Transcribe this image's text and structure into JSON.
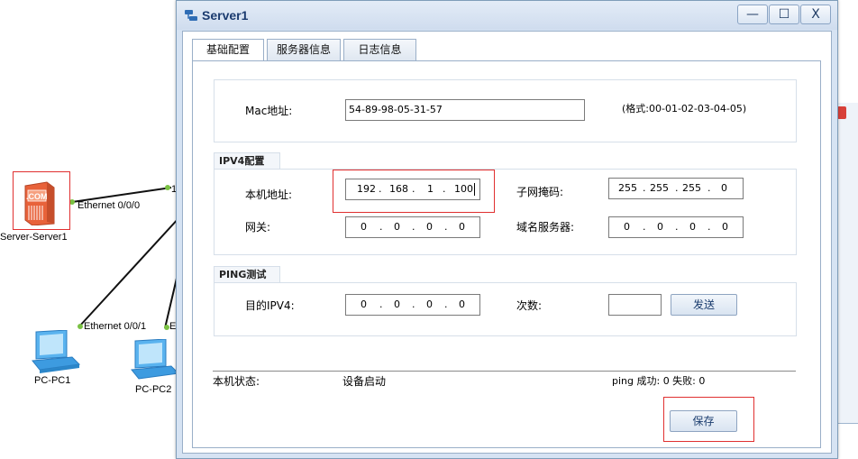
{
  "window": {
    "title": "Server1",
    "min_glyph": "—",
    "max_glyph": "☐",
    "close_glyph": "X"
  },
  "tabs": [
    {
      "label": "基础配置",
      "active": true
    },
    {
      "label": "服务器信息",
      "active": false
    },
    {
      "label": "日志信息",
      "active": false
    }
  ],
  "mac": {
    "label": "Mac地址:",
    "value": "54-89-98-05-31-57",
    "format_hint": "(格式:00-01-02-03-04-05)"
  },
  "ipv4": {
    "legend": "IPV4配置",
    "local_ip_label": "本机地址:",
    "local_ip": [
      "192",
      "168",
      "1",
      "100"
    ],
    "subnet_label": "子网掩码:",
    "subnet": [
      "255",
      "255",
      "255",
      "0"
    ],
    "gateway_label": "网关:",
    "gateway": [
      "0",
      "0",
      "0",
      "0"
    ],
    "dns_label": "域名服务器:",
    "dns": [
      "0",
      "0",
      "0",
      "0"
    ]
  },
  "ping": {
    "legend": "PING测试",
    "dest_label": "目的IPV4:",
    "dest": [
      "0",
      "0",
      "0",
      "0"
    ],
    "count_label": "次数:",
    "count_value": "",
    "send_label": "发送"
  },
  "status": {
    "label": "本机状态:",
    "value": "设备启动",
    "ping_result": "ping 成功: 0 失败: 0"
  },
  "save_label": "保存",
  "topology": {
    "server_name": "Server-Server1",
    "server_badge": ".COM",
    "link_server": "Ethernet 0/0/0",
    "link_pc1": "Ethernet 0/0/1",
    "link_pc2_partial": "E",
    "switch_partial": "1",
    "pc1_name": "PC-PC1",
    "pc2_name": "PC-PC2"
  },
  "colors": {
    "selection_red": "#e03030",
    "server_orange": "#e8623a",
    "pc_blue": "#3d9be0",
    "link_dot": "#7ac143"
  }
}
